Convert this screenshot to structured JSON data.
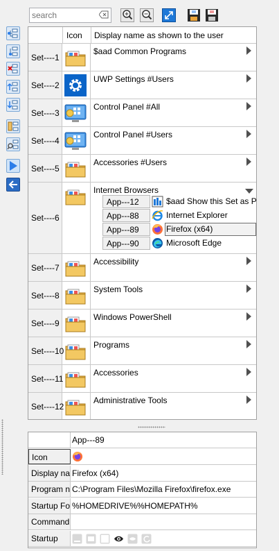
{
  "search": {
    "placeholder": "search"
  },
  "toolbar": {
    "zoom_in": "zoom-in-icon",
    "zoom_out": "zoom-out-icon",
    "fit": "fit-window-icon",
    "save_tree": "save-tree-icon",
    "save_disk": "save-disk-icon"
  },
  "left_toolbar": [
    "add-set-icon",
    "insert-set-icon",
    "delete-set-icon",
    "move-up-icon",
    "move-down-icon",
    "copy-set-icon",
    "find-set-icon",
    "play-icon",
    "back-icon"
  ],
  "grid": {
    "header": {
      "icon": "Icon",
      "name": "Display name as shown to the user"
    },
    "sets": [
      {
        "id": "Set----1",
        "name": "$aad Common Programs",
        "icon": "folder-programs-icon"
      },
      {
        "id": "Set----2",
        "name": "UWP Settings #Users",
        "icon": "settings-gear-icon"
      },
      {
        "id": "Set----3",
        "name": "Control Panel #All",
        "icon": "control-panel-icon"
      },
      {
        "id": "Set----4",
        "name": "Control Panel #Users",
        "icon": "control-panel-icon"
      },
      {
        "id": "Set----5",
        "name": "Accessories #Users",
        "icon": "folder-programs-icon"
      },
      {
        "id": "Set----6",
        "name": "Internet Browsers",
        "icon": "folder-programs-icon",
        "expanded": true,
        "apps": [
          {
            "id": "App---12",
            "name": "$aad Show this Set as Pa",
            "icon": "set-panel-icon"
          },
          {
            "id": "App---88",
            "name": "Internet Explorer",
            "icon": "internet-explorer-icon"
          },
          {
            "id": "App---89",
            "name": "Firefox (x64)",
            "icon": "firefox-icon",
            "selected": true
          },
          {
            "id": "App---90",
            "name": "Microsoft Edge",
            "icon": "edge-icon"
          }
        ]
      },
      {
        "id": "Set----7",
        "name": "Accessibility",
        "icon": "folder-programs-icon"
      },
      {
        "id": "Set----8",
        "name": "System Tools",
        "icon": "folder-programs-icon"
      },
      {
        "id": "Set----9",
        "name": "Windows PowerShell",
        "icon": "folder-programs-icon"
      },
      {
        "id": "Set----10",
        "name": "Programs",
        "icon": "folder-programs-icon"
      },
      {
        "id": "Set----11",
        "name": "Accessories",
        "icon": "folder-programs-icon"
      },
      {
        "id": "Set----12",
        "name": "Administrative Tools",
        "icon": "folder-programs-icon"
      }
    ]
  },
  "properties": {
    "title": "App---89",
    "rows": [
      {
        "label": "Icon",
        "value": "",
        "icon": "firefox-icon"
      },
      {
        "label": "Display nar",
        "value": "Firefox (x64)"
      },
      {
        "label": "Program na",
        "value": "C:\\Program Files\\Mozilla Firefox\\firefox.exe"
      },
      {
        "label": "Startup Fol",
        "value": "%HOMEDRIVE%%HOMEPATH%"
      },
      {
        "label": "Commandlir",
        "value": ""
      },
      {
        "label": "Startup",
        "value": "",
        "icons": [
          "startup-minimized-icon",
          "startup-normal-icon",
          "startup-maximized-icon",
          "startup-visible-icon",
          "startup-hidden-icon",
          "startup-refresh-icon"
        ]
      }
    ]
  }
}
